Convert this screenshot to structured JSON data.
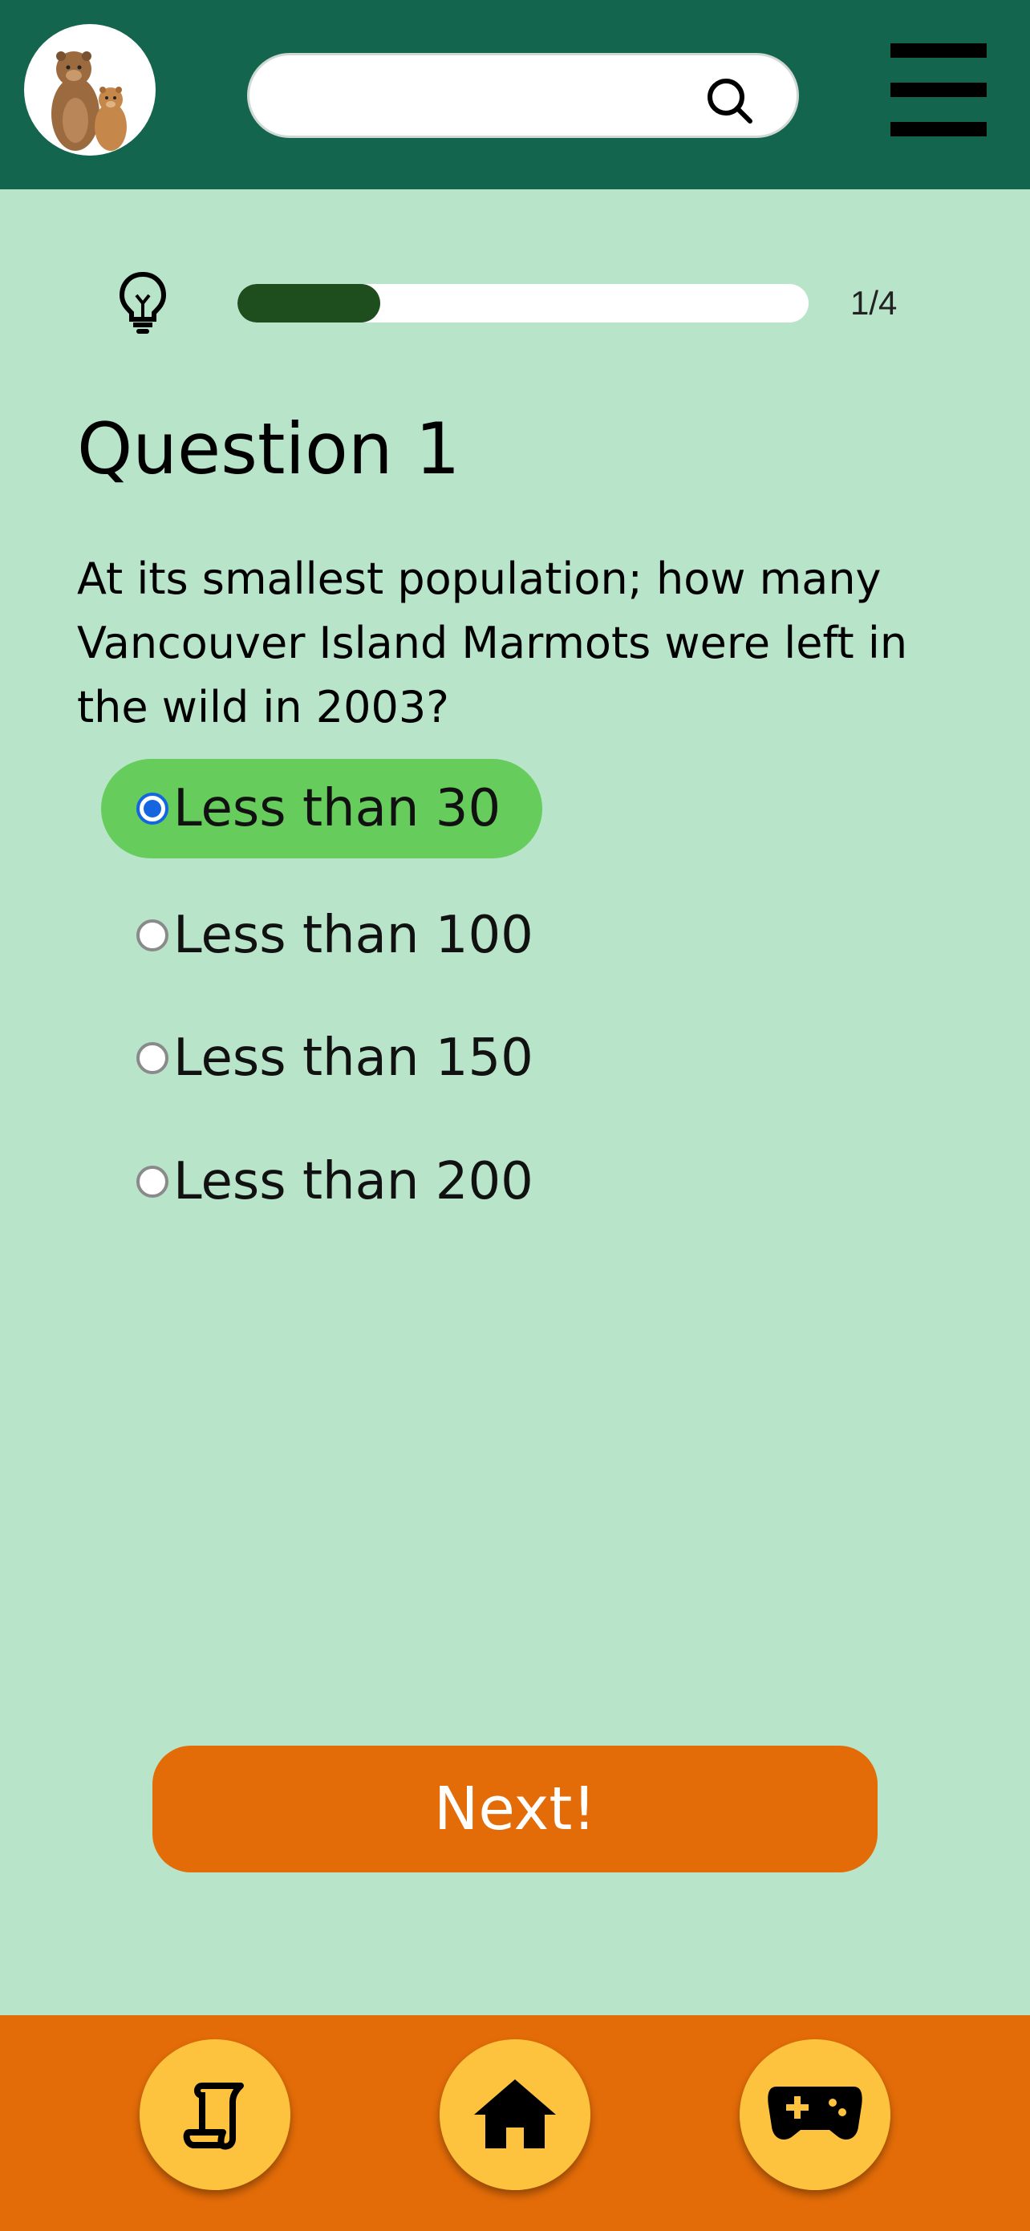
{
  "header": {
    "search_placeholder": "",
    "logo_icon": "marmot-logo-icon",
    "search_icon": "search-icon",
    "menu_icon": "hamburger-menu-icon"
  },
  "progress": {
    "current": 1,
    "total": 4,
    "label": "1/4",
    "fill_fraction": 0.25,
    "hint_icon": "lightbulb-icon"
  },
  "question": {
    "title": "Question 1",
    "text": "At its smallest population; how many Vancouver Island Marmots were left in the wild in 2003?"
  },
  "options": [
    {
      "label": "Less than 30",
      "selected": true
    },
    {
      "label": "Less than 100",
      "selected": false
    },
    {
      "label": "Less than 150",
      "selected": false
    },
    {
      "label": "Less than 200",
      "selected": false
    }
  ],
  "next_button": {
    "label": "Next!"
  },
  "bottom_nav": {
    "items": [
      {
        "name": "scroll-icon"
      },
      {
        "name": "home-icon"
      },
      {
        "name": "gamepad-icon"
      }
    ]
  },
  "colors": {
    "header_bg": "#13654e",
    "page_bg": "#b8e4c9",
    "selected_option": "#66cc5c",
    "accent_orange": "#e36c08",
    "nav_button": "#fdc33f",
    "progress_fill": "#1e4d1e"
  }
}
